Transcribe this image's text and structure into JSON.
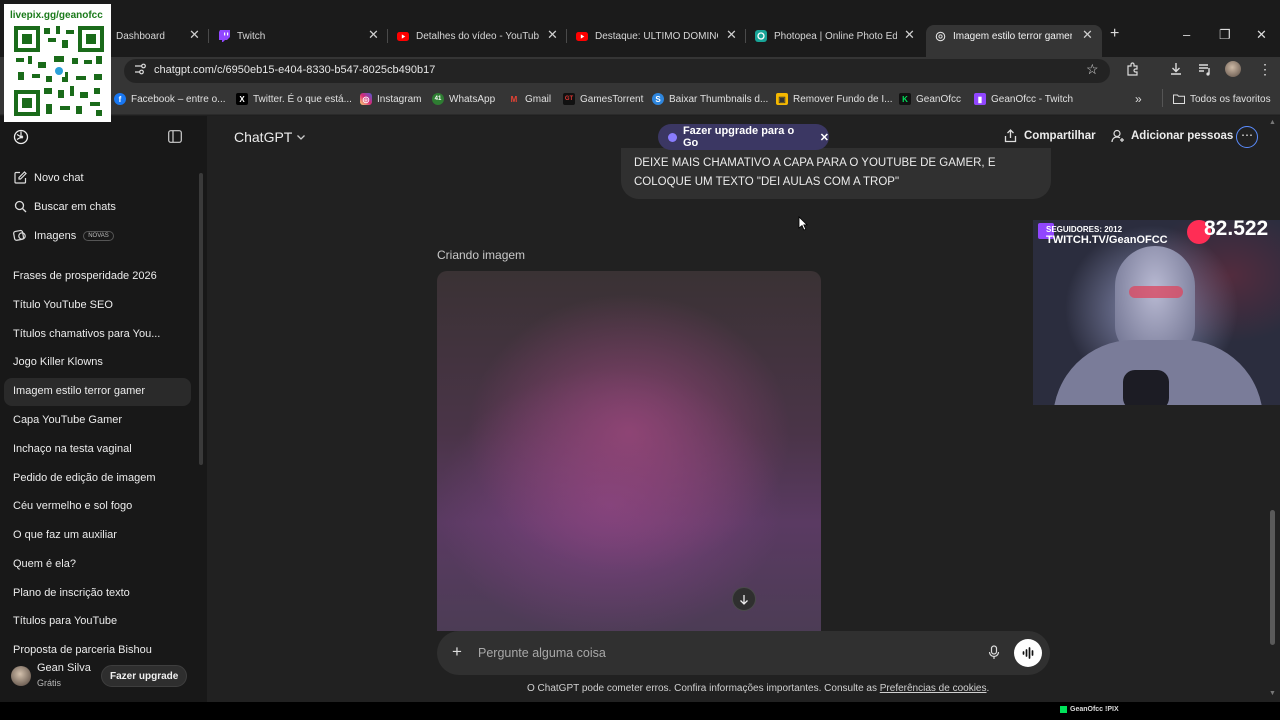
{
  "qr": {
    "caption": "livepix.gg/geanofcc"
  },
  "browser": {
    "tabs": [
      {
        "title": "Dashboard",
        "icon": "dashboard-icon"
      },
      {
        "title": "Twitch",
        "icon": "twitch-icon"
      },
      {
        "title": "Detalhes do vídeo - YouTube",
        "icon": "youtube-icon"
      },
      {
        "title": "Destaque: ULTIMO DOMINGO",
        "icon": "youtube-icon"
      },
      {
        "title": "Photopea | Online Photo Editor",
        "icon": "photopea-icon"
      },
      {
        "title": "Imagem estilo terror gamer",
        "icon": "chatgpt-icon",
        "active": true
      }
    ],
    "url": "chatgpt.com/c/6950eb15-e404-8330-b547-8025cb490b17",
    "bookmarks": [
      {
        "label": "Facebook – entre o...",
        "color": "#1877f2",
        "glyph": "f"
      },
      {
        "label": "Twitter. É o que está...",
        "color": "#000000",
        "glyph": "X"
      },
      {
        "label": "Instagram",
        "color": "#d6249f",
        "glyph": "◎"
      },
      {
        "label": "WhatsApp",
        "color": "#25d366",
        "glyph": "41"
      },
      {
        "label": "Gmail",
        "color": "#ea4335",
        "glyph": "M"
      },
      {
        "label": "GamesTorrent",
        "color": "#c0392b",
        "glyph": "GT"
      },
      {
        "label": "Baixar Thumbnails d...",
        "color": "#2e86de",
        "glyph": "S"
      },
      {
        "label": "Remover Fundo de I...",
        "color": "#f5b800",
        "glyph": "▣"
      },
      {
        "label": "GeanOfcc",
        "color": "#00c853",
        "glyph": "K"
      },
      {
        "label": "GeanOfcc - Twitch",
        "color": "#9146ff",
        "glyph": "▮"
      }
    ],
    "all_bookmarks": "Todos os favoritos"
  },
  "sidebar": {
    "new_chat": "Novo chat",
    "search_chats": "Buscar em chats",
    "images": "Imagens",
    "images_badge": "NOVAS",
    "conversations": [
      "Frases de prosperidade 2026",
      "Título YouTube SEO",
      "Títulos chamativos para You...",
      "Jogo Killer Klowns",
      "Imagem estilo terror gamer",
      "Capa YouTube Gamer",
      "Inchaço na testa vaginal",
      "Pedido de edição de imagem",
      "Céu vermelho e sol fogo",
      "O que faz um auxiliar",
      "Quem é ela?",
      "Plano de inscrição texto",
      "Títulos para YouTube",
      "Proposta de parceria Bishou"
    ],
    "active_index": 4,
    "user_name": "Gean Silva",
    "user_plan": "Grátis",
    "upgrade_button": "Fazer upgrade"
  },
  "header": {
    "model": "ChatGPT",
    "upgrade_pill": "Fazer upgrade para o Go",
    "share": "Compartilhar",
    "add_people": "Adicionar pessoas"
  },
  "chat": {
    "user_message": "DEIXE MAIS CHAMATIVO A CAPA PARA O YOUTUBE DE GAMER, E COLOQUE UM TEXTO \"DEI AULAS COM A TROP\"",
    "generating_label": "Criando imagem",
    "composer_placeholder": "Pergunte alguma coisa",
    "disclaimer": "O ChatGPT pode cometer erros. Confira informações importantes. Consulte as",
    "disclaimer_link": "Preferências de cookies",
    "disclaimer_end": "."
  },
  "stream_overlay": {
    "followers": "SEGUIDORES: 2012",
    "channel": "TWITCH.TV/GeanOFCC",
    "count": "82.522",
    "status": "GeanOfcc !PIX"
  }
}
